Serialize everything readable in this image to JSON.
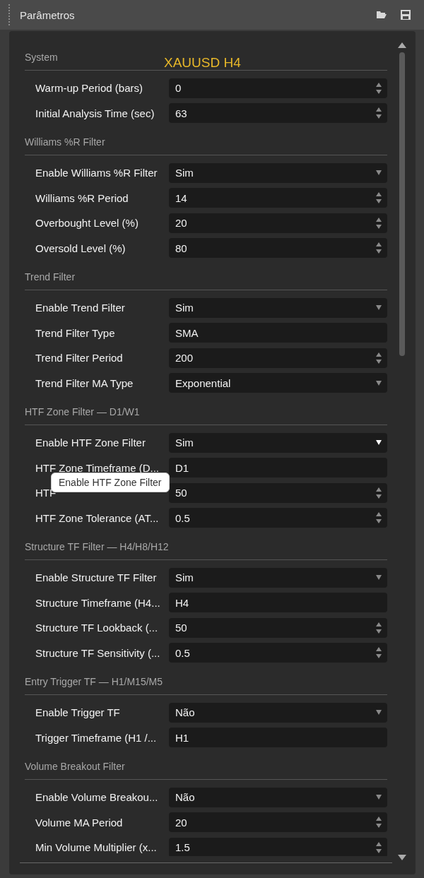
{
  "panel": {
    "title": "Parâmetros"
  },
  "overlay_label": "XAUUSD H4",
  "tooltip": "Enable HTF Zone Filter",
  "sections": [
    {
      "title": "System",
      "rows": [
        {
          "label": "Warm-up Period (bars)",
          "value": "0",
          "kind": "spin"
        },
        {
          "label": "Initial Analysis Time (sec)",
          "value": "63",
          "kind": "spin"
        }
      ]
    },
    {
      "title": "Williams %R Filter",
      "rows": [
        {
          "label": "Enable Williams %R Filter",
          "value": "Sim",
          "kind": "dropdown",
          "focused": false
        },
        {
          "label": "Williams %R Period",
          "value": "14",
          "kind": "spin"
        },
        {
          "label": "Overbought Level (%)",
          "value": "20",
          "kind": "spin"
        },
        {
          "label": "Oversold Level (%)",
          "value": "80",
          "kind": "spin"
        }
      ]
    },
    {
      "title": "Trend Filter",
      "rows": [
        {
          "label": "Enable Trend Filter",
          "value": "Sim",
          "kind": "dropdown",
          "focused": false
        },
        {
          "label": "Trend Filter Type",
          "value": "SMA",
          "kind": "text"
        },
        {
          "label": "Trend Filter Period",
          "value": "200",
          "kind": "spin"
        },
        {
          "label": "Trend Filter MA Type",
          "value": "Exponential",
          "kind": "dropdown",
          "focused": false
        }
      ]
    },
    {
      "title": "HTF Zone Filter — D1/W1",
      "rows": [
        {
          "label": "Enable HTF Zone Filter",
          "value": "Sim",
          "kind": "dropdown",
          "focused": true
        },
        {
          "label": "HTF Zone Timeframe (D...",
          "value": "D1",
          "kind": "text"
        },
        {
          "label": "HTF",
          "value": "50",
          "kind": "spin"
        },
        {
          "label": "HTF Zone Tolerance (AT...",
          "value": "0.5",
          "kind": "spin"
        }
      ]
    },
    {
      "title": "Structure TF Filter — H4/H8/H12",
      "rows": [
        {
          "label": "Enable Structure TF Filter",
          "value": "Sim",
          "kind": "dropdown",
          "focused": false
        },
        {
          "label": "Structure Timeframe (H4...",
          "value": "H4",
          "kind": "text"
        },
        {
          "label": "Structure TF Lookback (...",
          "value": "50",
          "kind": "spin"
        },
        {
          "label": "Structure TF Sensitivity (...",
          "value": "0.5",
          "kind": "spin"
        }
      ]
    },
    {
      "title": "Entry Trigger TF — H1/M15/M5",
      "rows": [
        {
          "label": "Enable Trigger TF",
          "value": "Não",
          "kind": "dropdown",
          "focused": false
        },
        {
          "label": "Trigger Timeframe (H1 /...",
          "value": "H1",
          "kind": "text"
        }
      ]
    },
    {
      "title": "Volume Breakout Filter",
      "rows": [
        {
          "label": "Enable Volume Breakou...",
          "value": "Não",
          "kind": "dropdown",
          "focused": false
        },
        {
          "label": "Volume MA Period",
          "value": "20",
          "kind": "spin"
        },
        {
          "label": "Min Volume Multiplier (x...",
          "value": "1.5",
          "kind": "spin"
        }
      ]
    }
  ]
}
